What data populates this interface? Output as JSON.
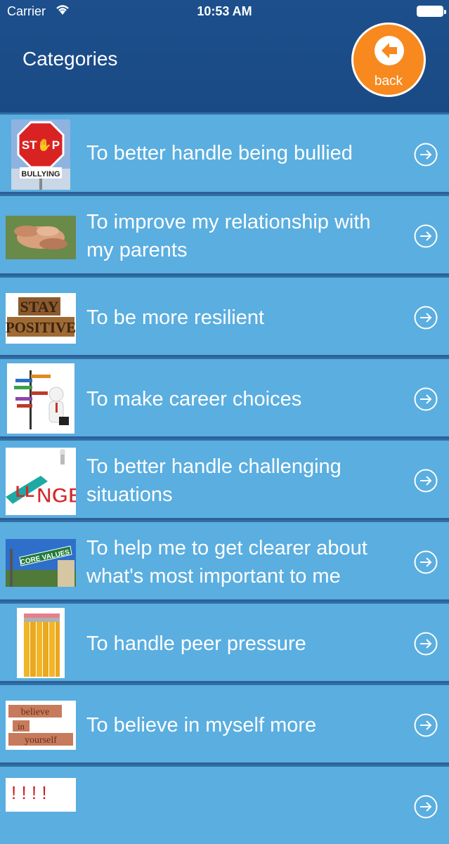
{
  "status_bar": {
    "carrier": "Carrier",
    "time": "10:53 AM"
  },
  "header": {
    "title": "Categories",
    "back_label": "back"
  },
  "colors": {
    "header": "#1c4f8c",
    "row": "#5aaee0",
    "back_button": "#f7891f"
  },
  "categories": [
    {
      "label": "To better handle being bullied",
      "icon": "stop-bullying-image"
    },
    {
      "label": "To improve my relationship with my parents",
      "icon": "stacked-hands-image"
    },
    {
      "label": "To be more resilient",
      "icon": "stay-positive-image"
    },
    {
      "label": "To make career choices",
      "icon": "career-signpost-image"
    },
    {
      "label": "To better handle challenging situations",
      "icon": "challenge-image"
    },
    {
      "label": "To help me to get clearer about what's most important to me",
      "icon": "core-values-sign-image"
    },
    {
      "label": "To handle peer pressure",
      "icon": "pencils-image"
    },
    {
      "label": "To believe in myself more",
      "icon": "believe-in-yourself-image"
    },
    {
      "label": "",
      "icon": "partial-row-image"
    }
  ]
}
